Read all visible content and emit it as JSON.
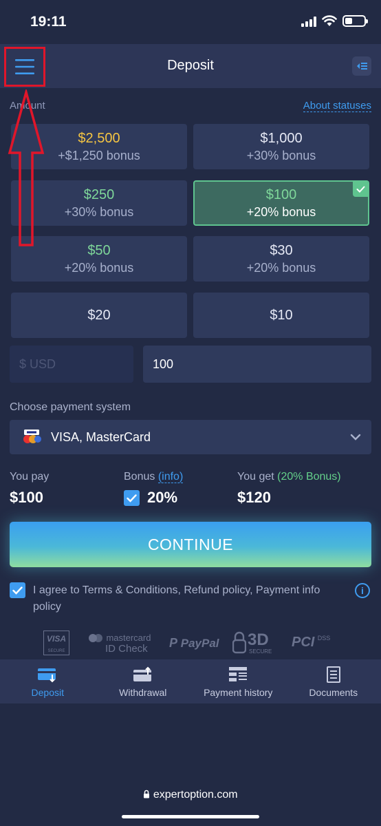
{
  "status_bar": {
    "time": "19:11"
  },
  "header": {
    "title": "Deposit"
  },
  "amount": {
    "label": "Amount",
    "about_statuses": "About statuses",
    "tiles": [
      {
        "amount": "$2,500",
        "bonus": "+$1,250 bonus",
        "amount_color": "#f5c542",
        "selected": false
      },
      {
        "amount": "$1,000",
        "bonus": "+30% bonus",
        "amount_color": "#e6e9f5",
        "selected": false
      },
      {
        "amount": "$250",
        "bonus": "+30% bonus",
        "amount_color": "#7fd89a",
        "selected": false
      },
      {
        "amount": "$100",
        "bonus": "+20% bonus",
        "amount_color": "#7fd89a",
        "selected": true
      },
      {
        "amount": "$50",
        "bonus": "+20% bonus",
        "amount_color": "#7fd89a",
        "selected": false
      },
      {
        "amount": "$30",
        "bonus": "+20% bonus",
        "amount_color": "#e6e9f5",
        "selected": false
      },
      {
        "amount": "$20",
        "bonus": "",
        "amount_color": "#e6e9f5",
        "selected": false
      },
      {
        "amount": "$10",
        "bonus": "",
        "amount_color": "#e6e9f5",
        "selected": false
      }
    ]
  },
  "currency": {
    "placeholder": "$ USD"
  },
  "amount_input": {
    "value": "100"
  },
  "payment": {
    "label": "Choose payment system",
    "selected": "VISA, MasterCard"
  },
  "summary": {
    "you_pay_label": "You pay",
    "you_pay_value": "$100",
    "bonus_label": "Bonus",
    "bonus_info": "(info)",
    "bonus_value": "20%",
    "you_get_label": "You get",
    "you_get_note": "(20% Bonus)",
    "you_get_value": "$120"
  },
  "continue_label": "CONTINUE",
  "agreement": {
    "text": "I agree to Terms & Conditions, Refund policy, Payment info policy"
  },
  "logos": {
    "visa": "VISA",
    "visa_sub": "SECURE",
    "mastercard_top": "mastercard",
    "mastercard_bottom": "ID Check",
    "paypal": "PayPal",
    "threed": "3D",
    "threed_sub": "SECURE",
    "pci": "PCI",
    "dss": "DSS"
  },
  "bottom_nav": [
    {
      "label": "Deposit",
      "active": true,
      "icon": "deposit-card-icon"
    },
    {
      "label": "Withdrawal",
      "active": false,
      "icon": "withdrawal-card-icon"
    },
    {
      "label": "Payment history",
      "active": false,
      "icon": "payment-history-icon"
    },
    {
      "label": "Documents",
      "active": false,
      "icon": "documents-icon"
    }
  ],
  "browser": {
    "url": "expertoption.com"
  },
  "colors": {
    "accent": "#3f9cf0",
    "selected_border": "#5fc48f",
    "annotation_red": "#e0162a"
  }
}
